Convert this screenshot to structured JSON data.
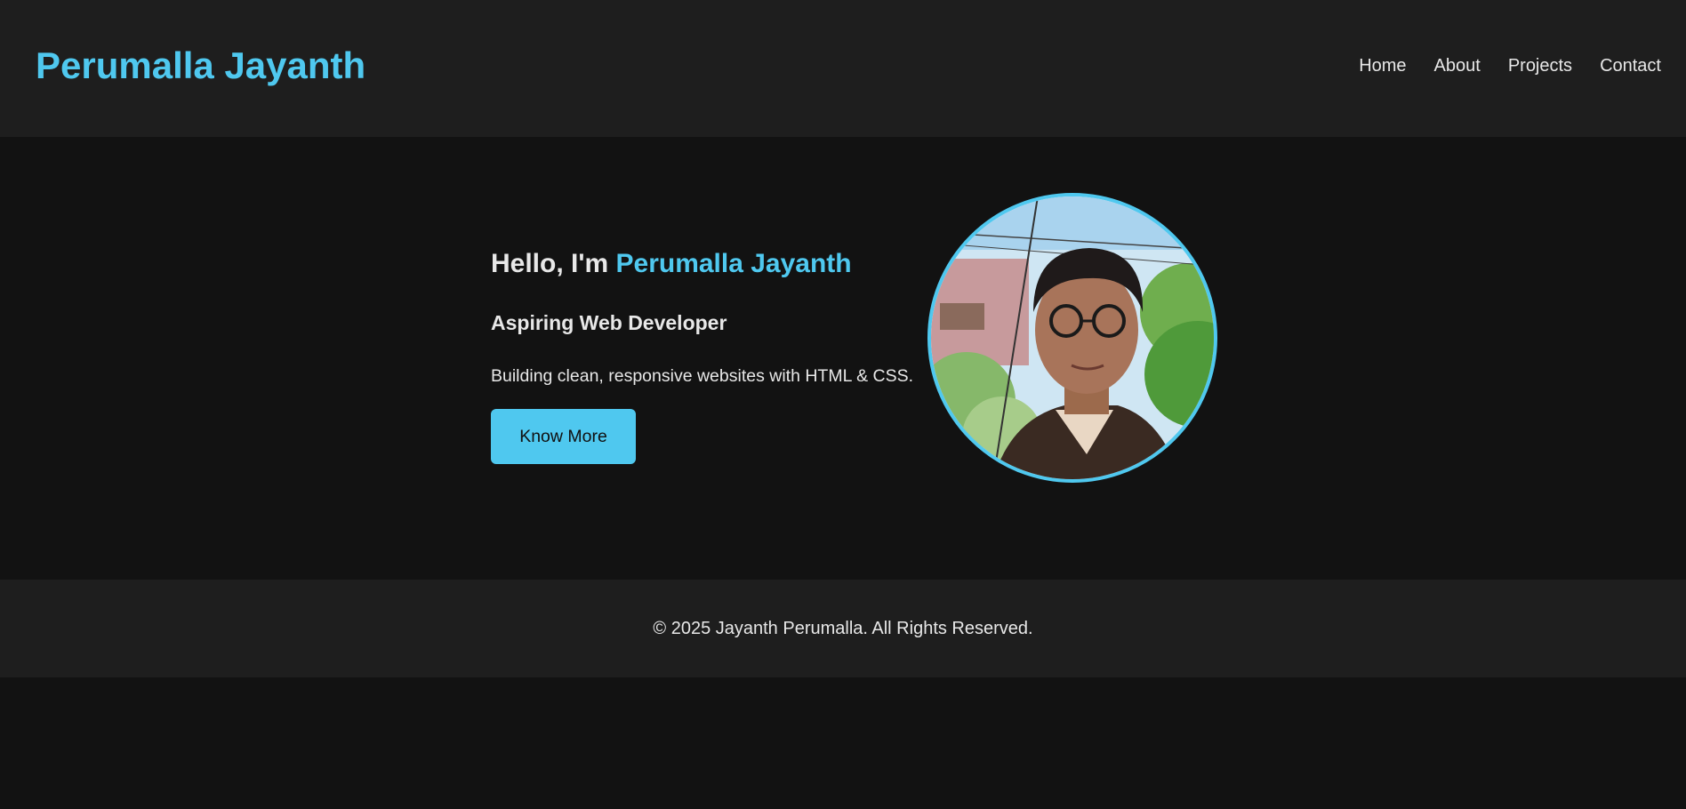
{
  "header": {
    "brand": "Perumalla Jayanth",
    "nav": [
      "Home",
      "About",
      "Projects",
      "Contact"
    ]
  },
  "hero": {
    "greeting_prefix": "Hello, I'm ",
    "greeting_name": "Perumalla Jayanth",
    "subtitle": "Aspiring Web Developer",
    "tagline": "Building clean, responsive websites with HTML & CSS.",
    "button_label": "Know More"
  },
  "footer": {
    "copyright": "© 2025 Jayanth Perumalla. All Rights Reserved."
  },
  "colors": {
    "accent": "#4fc8ef",
    "header_bg": "#1e1e1e",
    "page_bg": "#121212",
    "text": "#e8e8e8"
  },
  "icons": {
    "profile_photo": "profile-photo"
  }
}
